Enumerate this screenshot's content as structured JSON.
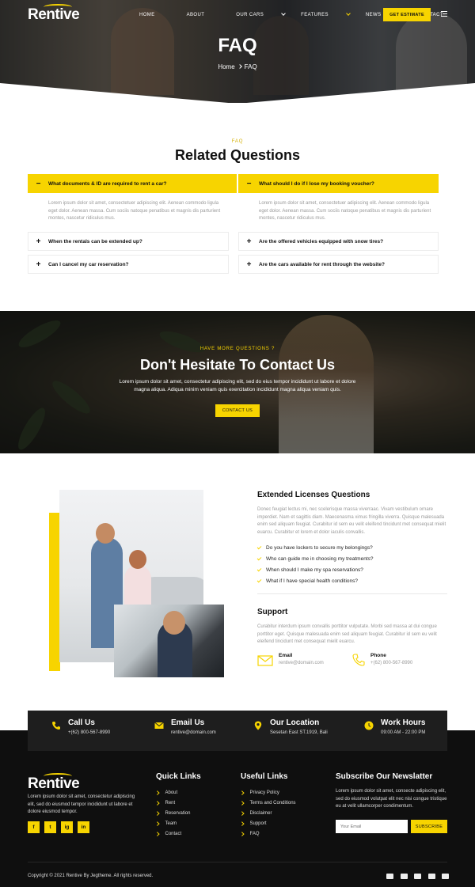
{
  "header": {
    "logo": "Rentive",
    "nav": [
      {
        "label": "HOME",
        "dropdown": false,
        "active": false
      },
      {
        "label": "ABOUT",
        "dropdown": false,
        "active": false
      },
      {
        "label": "OUR CARS",
        "dropdown": true,
        "active": false
      },
      {
        "label": "FEATURES",
        "dropdown": true,
        "active": true
      },
      {
        "label": "NEWS",
        "dropdown": true,
        "active": false
      },
      {
        "label": "CONTACT",
        "dropdown": false,
        "active": false
      }
    ],
    "cta": "GET ESTIMATE",
    "menu_icon": "hamburger-icon"
  },
  "hero": {
    "title": "FAQ",
    "breadcrumb_home": "Home",
    "breadcrumb_current": "FAQ"
  },
  "faq": {
    "eyebrow": "FAQ",
    "title": "Related Questions",
    "left": [
      {
        "q": "What documents & ID are required to rent a car?",
        "open": true,
        "sym": "−",
        "a": "Lorem ipsum dolor sit amet, consectetuer adipiscing elit. Aenean commodo ligula eget dolor. Aenean massa. Cum sociis natoque penatibus et magnis dis parturient montes, nascetur ridiculus mus."
      },
      {
        "q": "When the rentals can be extended up?",
        "open": false,
        "sym": "+"
      },
      {
        "q": "Can I cancel my car reservation?",
        "open": false,
        "sym": "+"
      }
    ],
    "right": [
      {
        "q": "What should I do if I lose my booking voucher?",
        "open": true,
        "sym": "−",
        "a": "Lorem ipsum dolor sit amet, consectetuer adipiscing elit. Aenean commodo ligula eget dolor. Aenean massa. Cum sociis natoque penatibus et magnis dis parturient montes, nascetur ridiculus mus."
      },
      {
        "q": "Are the offered vehicles equipped with snow tires?",
        "open": false,
        "sym": "+"
      },
      {
        "q": "Are the cars available for rent through the website?",
        "open": false,
        "sym": "+"
      }
    ]
  },
  "contact_band": {
    "eyebrow": "HAVE MORE QUESTIONS ?",
    "title": "Don't Hesitate To Contact Us",
    "text": "Lorem ipsum dolor sit amet, consectetur adipiscing elit, sed do eius tempor incididunt ut labore et dolore magna aliqua. Adiqua minim veniam quis exercitation incididunt magna aliqua veniam quis.",
    "button": "CONTACT US"
  },
  "extended": {
    "title": "Extended Licenses Questions",
    "text": "Donec feugiat lectus mi, nec scelerisque massa viverraac. Vivam vestibulum ornare imperdiet. Nam et sagittis diam. Maecenasma ximus fringilla viverra. Quisque malesuada enim sed aliquam feugiat. Curabitur id sem eu velit eleifend tincidunt met consequat mielit euarcu. Curabitur et lorem et dolor iaculis convallis.",
    "checklist": [
      "Do you have lockers to secure my belongings?",
      "Who can guide me in choosing my treatments?",
      "When should I make my spa reservations?",
      "What if I have special health conditions?"
    ],
    "support_title": "Support",
    "support_text": "Curabitur interdum ipsum convallis porttitor vulputate. Morbi sed massa at dui congue porttitor eget. Quisque malesuada enim sed aliquam feugiat. Curabitur id sem eu velit eleifend tincidunt met consequat mielit euarcu.",
    "email_label": "Email",
    "email_value": "rentive@domain.com",
    "phone_label": "Phone",
    "phone_value": "+(62) 800-567-8990"
  },
  "infobar": [
    {
      "title": "Call Us",
      "value": "+(62) 800-567-8990",
      "icon": "phone-icon"
    },
    {
      "title": "Email Us",
      "value": "rentive@domain.com",
      "icon": "envelope-icon"
    },
    {
      "title": "Our Location",
      "value": "Sesetan East ST.1919, Bali",
      "icon": "map-pin-icon"
    },
    {
      "title": "Work Hours",
      "value": "09:00 AM - 22:00 PM",
      "icon": "clock-icon"
    }
  ],
  "footer": {
    "logo": "Rentive",
    "about": "Lorem ipsum dolor sit amet, consectetur adipiscing elit, sed do eiusmod tempor incididunt ut labore et dolore eiusmod tempor.",
    "social": [
      "f",
      "t",
      "ig",
      "in"
    ],
    "quick_title": "Quick Links",
    "quick_links": [
      "About",
      "Rent",
      "Reservation",
      "Team",
      "Contact"
    ],
    "useful_title": "Useful Links",
    "useful_links": [
      "Privacy Policy",
      "Terms and Conditions",
      "Disclaimer",
      "Support",
      "FAQ"
    ],
    "news_title": "Subscribe Our Newslatter",
    "news_text": "Lorem ipsum dolor sit amet, consecte adipiscing elit, sed do eiusmod volutpat elit nec nisi congue tristique eu at velit ullamcorper condimentum.",
    "email_placeholder": "Your Email",
    "subscribe": "SUBSCRIBE",
    "copyright": "Copyright © 2021 Rentive By Jegtheme. All rights reserved.",
    "payments": [
      "mastercard-icon",
      "amex-icon",
      "visa-icon",
      "credit-card-icon",
      "paypal-icon"
    ]
  },
  "colors": {
    "accent": "#f7d400",
    "dark": "#0f0f0f",
    "bar": "#1e1e1e"
  }
}
